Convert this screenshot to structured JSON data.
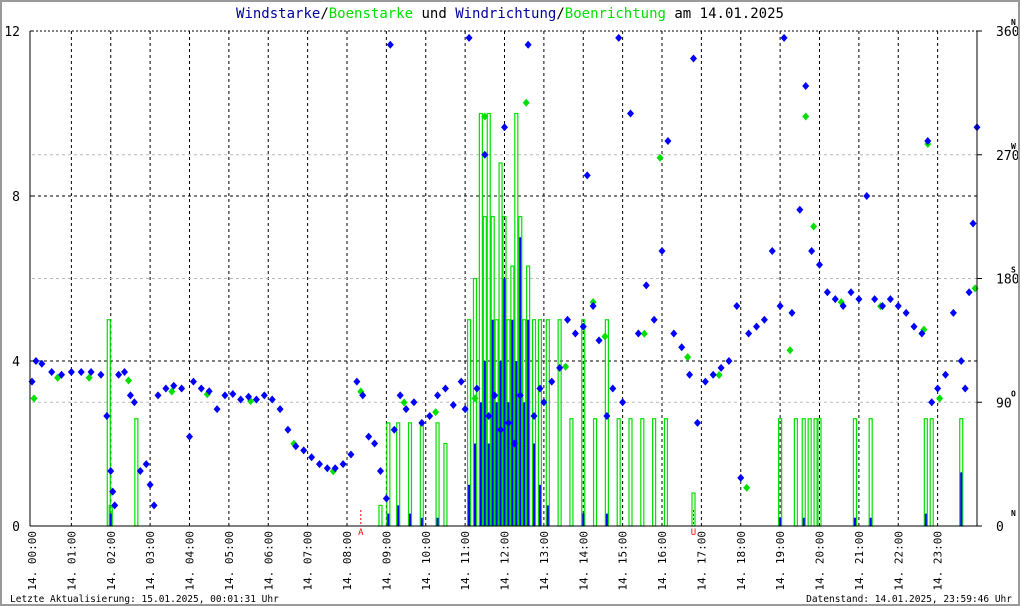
{
  "chart_data": {
    "type": "scatter",
    "title_parts": [
      {
        "text": "Windstarke",
        "color": "#0000a0"
      },
      {
        "text": "/",
        "color": "#000000"
      },
      {
        "text": "Boenstarke",
        "color": "#00e000"
      },
      {
        "text": " und ",
        "color": "#000000"
      },
      {
        "text": "Windrichtung",
        "color": "#0000a0"
      },
      {
        "text": "/",
        "color": "#000000"
      },
      {
        "text": "Boenrichtung",
        "color": "#00e000"
      },
      {
        "text": " am 14.01.2025",
        "color": "#000000"
      }
    ],
    "ylim_left": [
      0,
      12
    ],
    "yticks_left": [
      "0",
      "4",
      "8",
      "12"
    ],
    "ylim_right": [
      0,
      360
    ],
    "yticks_right": [
      "0",
      "90",
      "180",
      "270",
      "360"
    ],
    "compass_labels": [
      "N",
      "O",
      "S",
      "W",
      "N"
    ],
    "xlim_hours": [
      0,
      24
    ],
    "xtick_labels": [
      "14. 00:00",
      "14. 01:00",
      "14. 02:00",
      "14. 03:00",
      "14. 04:00",
      "14. 05:00",
      "14. 06:00",
      "14. 07:00",
      "14. 08:00",
      "14. 09:00",
      "14. 10:00",
      "14. 11:00",
      "14. 12:00",
      "14. 13:00",
      "14. 14:00",
      "14. 15:00",
      "14. 16:00",
      "14. 17:00",
      "14. 18:00",
      "14. 19:00",
      "14. 20:00",
      "14. 21:00",
      "14. 22:00",
      "14. 23:00"
    ],
    "sun_markers": [
      {
        "hour": 8.35,
        "label": "A"
      },
      {
        "hour": 16.8,
        "label": "U"
      }
    ],
    "colors": {
      "wind": "#0000ff",
      "gust": "#00e000",
      "sun": "#ff0000"
    },
    "bars_hour_speed_gust": [
      [
        1.95,
        0,
        5.0
      ],
      [
        2.0,
        0.3,
        0.5
      ],
      [
        2.65,
        0,
        2.6
      ],
      [
        8.85,
        0,
        0.5
      ],
      [
        9.05,
        0.3,
        2.5
      ],
      [
        9.3,
        0.5,
        2.5
      ],
      [
        9.6,
        0.3,
        2.5
      ],
      [
        9.9,
        0.2,
        2.5
      ],
      [
        10.3,
        0.2,
        2.5
      ],
      [
        10.5,
        0,
        2.0
      ],
      [
        11.1,
        1,
        5
      ],
      [
        11.25,
        2,
        6
      ],
      [
        11.4,
        3,
        10
      ],
      [
        11.5,
        4,
        7.5
      ],
      [
        11.6,
        2,
        10
      ],
      [
        11.7,
        5,
        7.5
      ],
      [
        11.8,
        3,
        5
      ],
      [
        11.9,
        4,
        8.8
      ],
      [
        12.0,
        6,
        7.5
      ],
      [
        12.1,
        3,
        5
      ],
      [
        12.2,
        5,
        6.3
      ],
      [
        12.3,
        4,
        10
      ],
      [
        12.4,
        7,
        7.5
      ],
      [
        12.5,
        3,
        5
      ],
      [
        12.6,
        5,
        6.3
      ],
      [
        12.75,
        2,
        5
      ],
      [
        12.9,
        1,
        5
      ],
      [
        13.1,
        0.5,
        5
      ],
      [
        13.4,
        0,
        5
      ],
      [
        13.7,
        0,
        2.6
      ],
      [
        14.0,
        0.3,
        5
      ],
      [
        14.3,
        0,
        2.6
      ],
      [
        14.6,
        0.3,
        5
      ],
      [
        14.9,
        0,
        2.6
      ],
      [
        15.2,
        0,
        2.6
      ],
      [
        15.5,
        0,
        2.6
      ],
      [
        15.8,
        0,
        2.6
      ],
      [
        16.1,
        0,
        2.6
      ],
      [
        16.8,
        0,
        0.8
      ],
      [
        19.0,
        0.2,
        2.6
      ],
      [
        19.4,
        0,
        2.6
      ],
      [
        19.6,
        0.2,
        2.6
      ],
      [
        19.75,
        0,
        2.6
      ],
      [
        19.9,
        0,
        2.6
      ],
      [
        20.0,
        0,
        2.6
      ],
      [
        20.9,
        0.2,
        2.6
      ],
      [
        21.3,
        0.2,
        2.6
      ],
      [
        22.7,
        0.3,
        2.6
      ],
      [
        22.85,
        0,
        2.6
      ],
      [
        23.6,
        1.3,
        2.6
      ]
    ],
    "gust_direction_hour_deg": [
      [
        0,
        95
      ],
      [
        0.6,
        110
      ],
      [
        1.4,
        110
      ],
      [
        2.4,
        108
      ],
      [
        3.5,
        100
      ],
      [
        4.4,
        98
      ],
      [
        5.5,
        93
      ],
      [
        6.6,
        62
      ],
      [
        7.6,
        42
      ],
      [
        8.3,
        100
      ],
      [
        9.4,
        92
      ],
      [
        10.2,
        85
      ],
      [
        11.2,
        95
      ],
      [
        11.45,
        300
      ],
      [
        12.5,
        310
      ],
      [
        13.5,
        118
      ],
      [
        14.2,
        165
      ],
      [
        14.5,
        140
      ],
      [
        15.5,
        142
      ],
      [
        15.9,
        270
      ],
      [
        16.6,
        125
      ],
      [
        17.4,
        112
      ],
      [
        18.1,
        30
      ],
      [
        19.2,
        130
      ],
      [
        19.6,
        300
      ],
      [
        19.8,
        220
      ],
      [
        20.5,
        165
      ],
      [
        21.5,
        162
      ],
      [
        22.6,
        145
      ],
      [
        22.7,
        280
      ],
      [
        23.0,
        95
      ],
      [
        23.9,
        175
      ]
    ],
    "wind_direction_hour_deg": [
      [
        0,
        105
      ],
      [
        0.1,
        120
      ],
      [
        0.25,
        118
      ],
      [
        0.5,
        112
      ],
      [
        0.75,
        110
      ],
      [
        1,
        112
      ],
      [
        1.25,
        112
      ],
      [
        1.5,
        112
      ],
      [
        1.75,
        110
      ],
      [
        1.9,
        80
      ],
      [
        2.0,
        40
      ],
      [
        2.05,
        25
      ],
      [
        2.1,
        15
      ],
      [
        2.2,
        110
      ],
      [
        2.35,
        112
      ],
      [
        2.5,
        95
      ],
      [
        2.6,
        90
      ],
      [
        2.75,
        40
      ],
      [
        2.9,
        45
      ],
      [
        3.0,
        30
      ],
      [
        3.1,
        15
      ],
      [
        3.2,
        95
      ],
      [
        3.4,
        100
      ],
      [
        3.6,
        102
      ],
      [
        3.8,
        100
      ],
      [
        4.0,
        65
      ],
      [
        4.1,
        105
      ],
      [
        4.3,
        100
      ],
      [
        4.5,
        98
      ],
      [
        4.7,
        85
      ],
      [
        4.9,
        95
      ],
      [
        5.1,
        96
      ],
      [
        5.3,
        92
      ],
      [
        5.5,
        94
      ],
      [
        5.7,
        92
      ],
      [
        5.9,
        95
      ],
      [
        6.1,
        92
      ],
      [
        6.3,
        85
      ],
      [
        6.5,
        70
      ],
      [
        6.7,
        58
      ],
      [
        6.9,
        55
      ],
      [
        7.1,
        50
      ],
      [
        7.3,
        45
      ],
      [
        7.5,
        42
      ],
      [
        7.7,
        42
      ],
      [
        7.9,
        45
      ],
      [
        8.1,
        52
      ],
      [
        8.25,
        105
      ],
      [
        8.4,
        95
      ],
      [
        8.55,
        65
      ],
      [
        8.7,
        60
      ],
      [
        8.85,
        40
      ],
      [
        9.0,
        20
      ],
      [
        9.1,
        350
      ],
      [
        9.2,
        70
      ],
      [
        9.35,
        95
      ],
      [
        9.5,
        85
      ],
      [
        9.7,
        90
      ],
      [
        9.9,
        75
      ],
      [
        10.1,
        80
      ],
      [
        10.3,
        95
      ],
      [
        10.5,
        100
      ],
      [
        10.7,
        88
      ],
      [
        10.9,
        105
      ],
      [
        11.0,
        85
      ],
      [
        11.1,
        355
      ],
      [
        11.3,
        100
      ],
      [
        11.5,
        270
      ],
      [
        11.6,
        80
      ],
      [
        11.75,
        95
      ],
      [
        11.9,
        70
      ],
      [
        12.0,
        290
      ],
      [
        12.1,
        75
      ],
      [
        12.25,
        60
      ],
      [
        12.4,
        95
      ],
      [
        12.6,
        350
      ],
      [
        12.75,
        80
      ],
      [
        12.9,
        100
      ],
      [
        13.0,
        90
      ],
      [
        13.2,
        105
      ],
      [
        13.4,
        115
      ],
      [
        13.6,
        150
      ],
      [
        13.8,
        140
      ],
      [
        14.0,
        145
      ],
      [
        14.1,
        255
      ],
      [
        14.25,
        160
      ],
      [
        14.4,
        135
      ],
      [
        14.6,
        80
      ],
      [
        14.75,
        100
      ],
      [
        14.9,
        355
      ],
      [
        15.0,
        90
      ],
      [
        15.2,
        300
      ],
      [
        15.4,
        140
      ],
      [
        15.6,
        175
      ],
      [
        15.8,
        150
      ],
      [
        16.0,
        200
      ],
      [
        16.15,
        280
      ],
      [
        16.3,
        140
      ],
      [
        16.5,
        130
      ],
      [
        16.7,
        110
      ],
      [
        16.8,
        340
      ],
      [
        16.9,
        75
      ],
      [
        17.1,
        105
      ],
      [
        17.3,
        110
      ],
      [
        17.5,
        115
      ],
      [
        17.7,
        120
      ],
      [
        17.9,
        160
      ],
      [
        18.0,
        35
      ],
      [
        18.2,
        140
      ],
      [
        18.4,
        145
      ],
      [
        18.6,
        150
      ],
      [
        18.8,
        200
      ],
      [
        19.0,
        160
      ],
      [
        19.1,
        355
      ],
      [
        19.3,
        155
      ],
      [
        19.5,
        230
      ],
      [
        19.65,
        320
      ],
      [
        19.8,
        200
      ],
      [
        20.0,
        190
      ],
      [
        20.2,
        170
      ],
      [
        20.4,
        165
      ],
      [
        20.6,
        160
      ],
      [
        20.8,
        170
      ],
      [
        21.0,
        165
      ],
      [
        21.2,
        240
      ],
      [
        21.4,
        165
      ],
      [
        21.6,
        160
      ],
      [
        21.8,
        165
      ],
      [
        22.0,
        160
      ],
      [
        22.2,
        155
      ],
      [
        22.4,
        145
      ],
      [
        22.6,
        140
      ],
      [
        22.75,
        280
      ],
      [
        22.85,
        90
      ],
      [
        23.0,
        100
      ],
      [
        23.2,
        110
      ],
      [
        23.4,
        155
      ],
      [
        23.6,
        120
      ],
      [
        23.7,
        100
      ],
      [
        23.8,
        170
      ],
      [
        23.9,
        220
      ],
      [
        24.0,
        290
      ]
    ]
  },
  "footer": {
    "last_update": "Letzte Aktualisierung: 15.01.2025, 00:01:31 Uhr",
    "data_status": "Datenstand: 14.01.2025, 23:59:46 Uhr"
  }
}
